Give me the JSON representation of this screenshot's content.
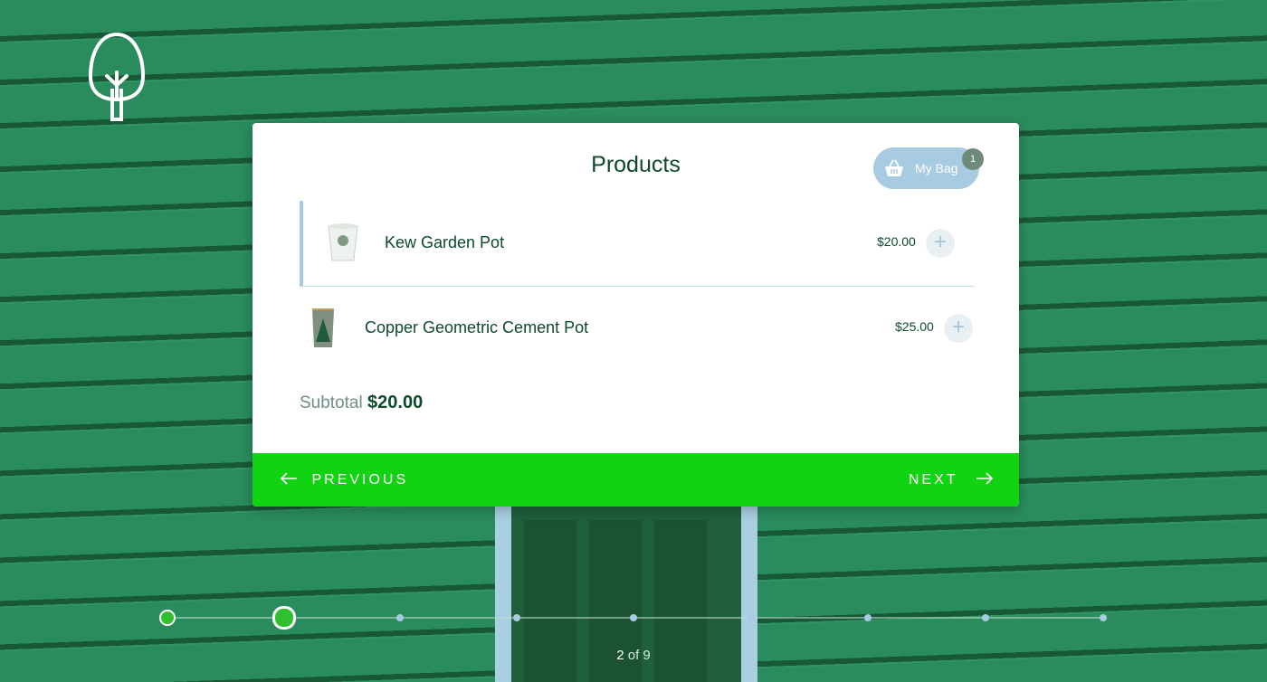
{
  "card": {
    "title": "Products",
    "bag": {
      "label": "My Bag",
      "count": "1"
    }
  },
  "products": [
    {
      "name": "Kew Garden Pot",
      "price": "$20.00",
      "add_label": "+"
    },
    {
      "name": "Copper Geometric Cement Pot",
      "price": "$25.00",
      "add_label": "+"
    }
  ],
  "subtotal": {
    "label": "Subtotal",
    "value": "$20.00"
  },
  "nav": {
    "previous_label": "PREVIOUS",
    "next_label": "NEXT"
  },
  "steps": {
    "current": "2",
    "separator": "of",
    "total": "9"
  },
  "colors": {
    "primary_green": "#12d312",
    "accent_blue": "#a7cbe0",
    "text_dark": "#0d4a2a"
  },
  "icons": [
    "tree-logo-icon",
    "basket-icon",
    "plus-icon",
    "arrow-left-icon",
    "arrow-right-icon"
  ]
}
